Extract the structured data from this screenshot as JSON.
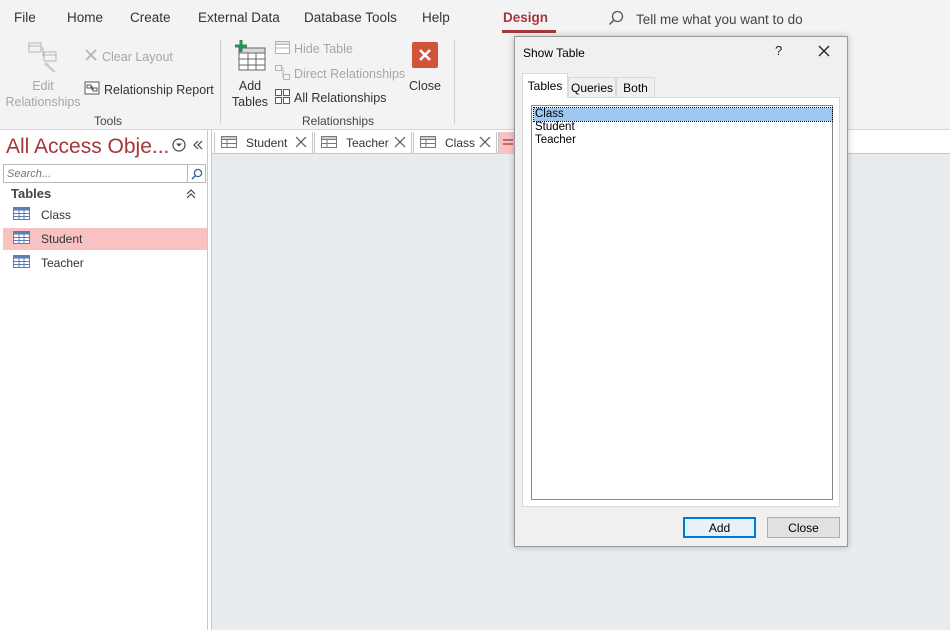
{
  "ribbon_tabs": [
    {
      "label": "File"
    },
    {
      "label": "Home"
    },
    {
      "label": "Create"
    },
    {
      "label": "External Data"
    },
    {
      "label": "Database Tools"
    },
    {
      "label": "Help"
    },
    {
      "label": "Design",
      "active": true
    }
  ],
  "tell_me": {
    "placeholder": "Tell me what you want to do"
  },
  "ribbon": {
    "tools": {
      "group_label": "Tools",
      "edit_relationships": {
        "line1": "Edit",
        "line2": "Relationships",
        "enabled": false
      },
      "clear_layout": {
        "label": "Clear Layout",
        "enabled": false
      },
      "relationship_report": {
        "label": "Relationship Report",
        "enabled": true
      }
    },
    "relationships": {
      "group_label": "Relationships",
      "add_tables": {
        "line1": "Add",
        "line2": "Tables"
      },
      "hide_table": {
        "label": "Hide Table",
        "enabled": false
      },
      "direct_relationships": {
        "label": "Direct Relationships",
        "enabled": false
      },
      "all_relationships": {
        "label": "All Relationships",
        "enabled": true
      },
      "close": {
        "label": "Close"
      }
    }
  },
  "nav_pane": {
    "title": "All Access Obje...",
    "search_placeholder": "Search...",
    "section": "Tables",
    "items": [
      {
        "label": "Class",
        "selected": false
      },
      {
        "label": "Student",
        "selected": true
      },
      {
        "label": "Teacher",
        "selected": false
      }
    ]
  },
  "doc_tabs": [
    {
      "label": "Student"
    },
    {
      "label": "Teacher"
    },
    {
      "label": "Class"
    }
  ],
  "dialog": {
    "title": "Show Table",
    "help": "?",
    "tabs": [
      {
        "label": "Tables",
        "active": true
      },
      {
        "label": "Queries",
        "active": false
      },
      {
        "label": "Both",
        "active": false
      }
    ],
    "list_items": [
      {
        "label": "Class",
        "selected": true
      },
      {
        "label": "Student",
        "selected": false
      },
      {
        "label": "Teacher",
        "selected": false
      }
    ],
    "add_button": "Add",
    "close_button": "Close"
  },
  "colors": {
    "accent": "#a4373a",
    "selected_nav": "#f8c2c3",
    "close_red": "#d0533a",
    "list_selection": "#9ec8f0"
  }
}
